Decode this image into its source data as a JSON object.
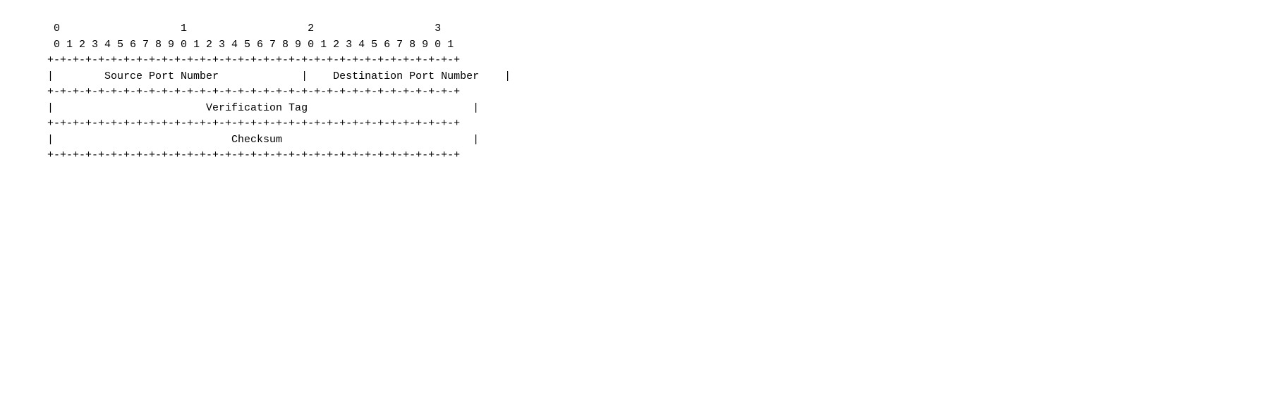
{
  "diagram": {
    "lines": [
      "    0                   1                   2                   3",
      "    0 1 2 3 4 5 6 7 8 9 0 1 2 3 4 5 6 7 8 9 0 1 2 3 4 5 6 7 8 9 0 1",
      "   +-+-+-+-+-+-+-+-+-+-+-+-+-+-+-+-+-+-+-+-+-+-+-+-+-+-+-+-+-+-+-+-+",
      "   |        Source Port Number             |    Destination Port Number    |",
      "   +-+-+-+-+-+-+-+-+-+-+-+-+-+-+-+-+-+-+-+-+-+-+-+-+-+-+-+-+-+-+-+-+",
      "   |                        Verification Tag                          |",
      "   +-+-+-+-+-+-+-+-+-+-+-+-+-+-+-+-+-+-+-+-+-+-+-+-+-+-+-+-+-+-+-+-+",
      "   |                            Checksum                              |",
      "   +-+-+-+-+-+-+-+-+-+-+-+-+-+-+-+-+-+-+-+-+-+-+-+-+-+-+-+-+-+-+-+-+"
    ]
  }
}
